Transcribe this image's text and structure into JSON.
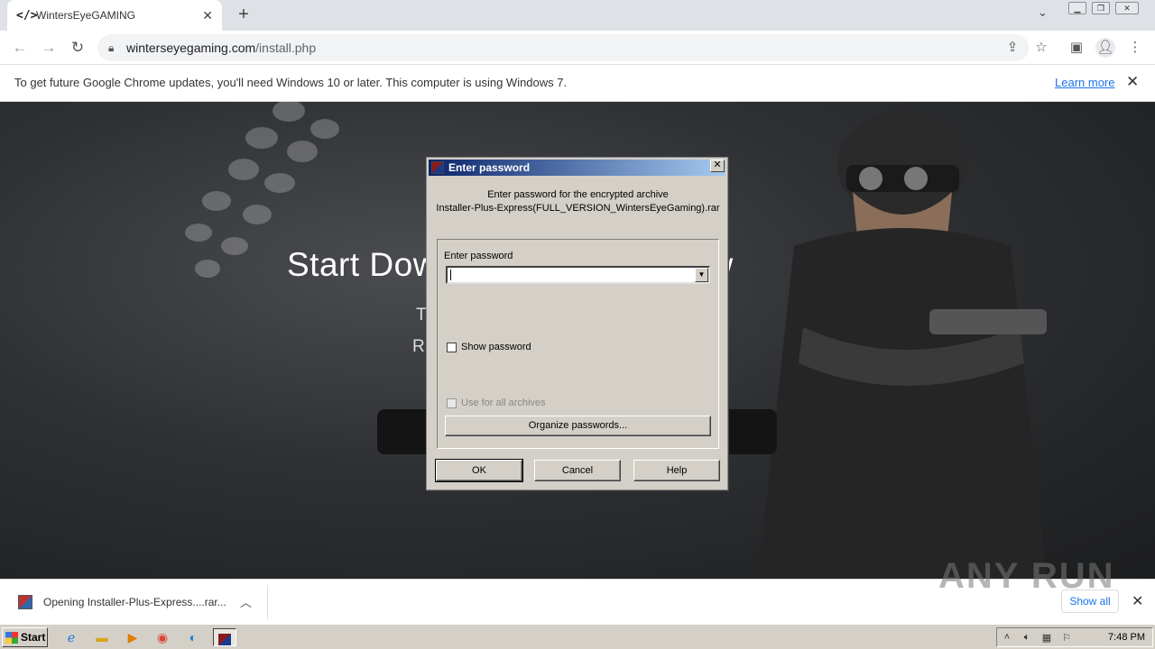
{
  "browser": {
    "tab": {
      "title": "WintersEyeGAMING",
      "favicon": "</>"
    },
    "new_tab": "+",
    "address": {
      "host": "winterseyegaming.com",
      "path": "/install.php"
    }
  },
  "infobar": {
    "message": "To get future Google Chrome updates, you'll need Windows 10 or later. This computer is using Windows 7.",
    "learn_more": "Learn more"
  },
  "page": {
    "heading": "Start Download Button Below",
    "sub1": "T                                              t.",
    "sub2": "R                                              e."
  },
  "dialog": {
    "title": "Enter password",
    "message_line1": "Enter password for the encrypted archive",
    "message_line2": "Installer-Plus-Express(FULL_VERSION_WintersEyeGaming).rar",
    "field_label": "Enter password",
    "password_value": "",
    "show_password": "Show password",
    "use_for_all": "Use for all archives",
    "organize": "Organize passwords...",
    "ok": "OK",
    "cancel": "Cancel",
    "help": "Help"
  },
  "downloads": {
    "item": "Opening Installer-Plus-Express....rar...",
    "show_all": "Show all",
    "watermark": "ANY RUN"
  },
  "taskbar": {
    "start": "Start",
    "clock": "7:48 PM"
  },
  "colors": {
    "dialog_bg": "#d4d0c8",
    "titlebar": "#0a246a",
    "link": "#1a73e8"
  }
}
